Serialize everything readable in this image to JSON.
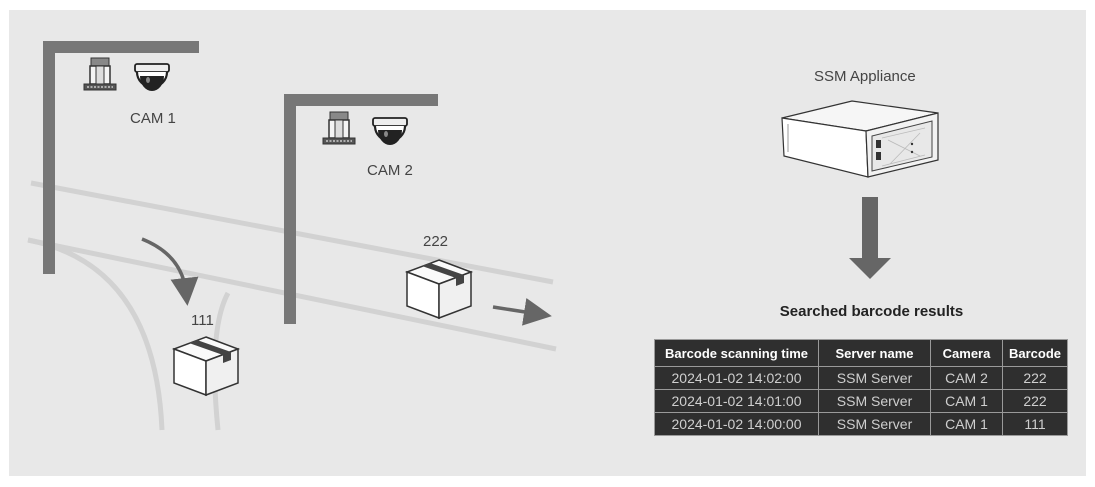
{
  "diagram": {
    "cam1_label": "CAM 1",
    "cam2_label": "CAM 2",
    "box1_label": "111",
    "box2_label": "222",
    "appliance_label": "SSM Appliance"
  },
  "results": {
    "title": "Searched barcode results",
    "columns": [
      "Barcode scanning time",
      "Server name",
      "Camera",
      "Barcode"
    ],
    "rows": [
      [
        "2024-01-02 14:02:00",
        "SSM Server",
        "CAM 2",
        "222"
      ],
      [
        "2024-01-02 14:01:00",
        "SSM Server",
        "CAM 1",
        "222"
      ],
      [
        "2024-01-02 14:00:00",
        "SSM Server",
        "CAM 1",
        "111"
      ]
    ]
  },
  "colors": {
    "panel_bg": "#e8e8e8",
    "pole": "#777777",
    "conveyor": "#d2d2d2",
    "arrow": "#666666",
    "table_bg": "#2f2f2f"
  },
  "icons": [
    "barcode-scanner-icon",
    "dome-camera-icon",
    "package-box-icon",
    "server-appliance-icon",
    "flow-arrow-icon"
  ]
}
